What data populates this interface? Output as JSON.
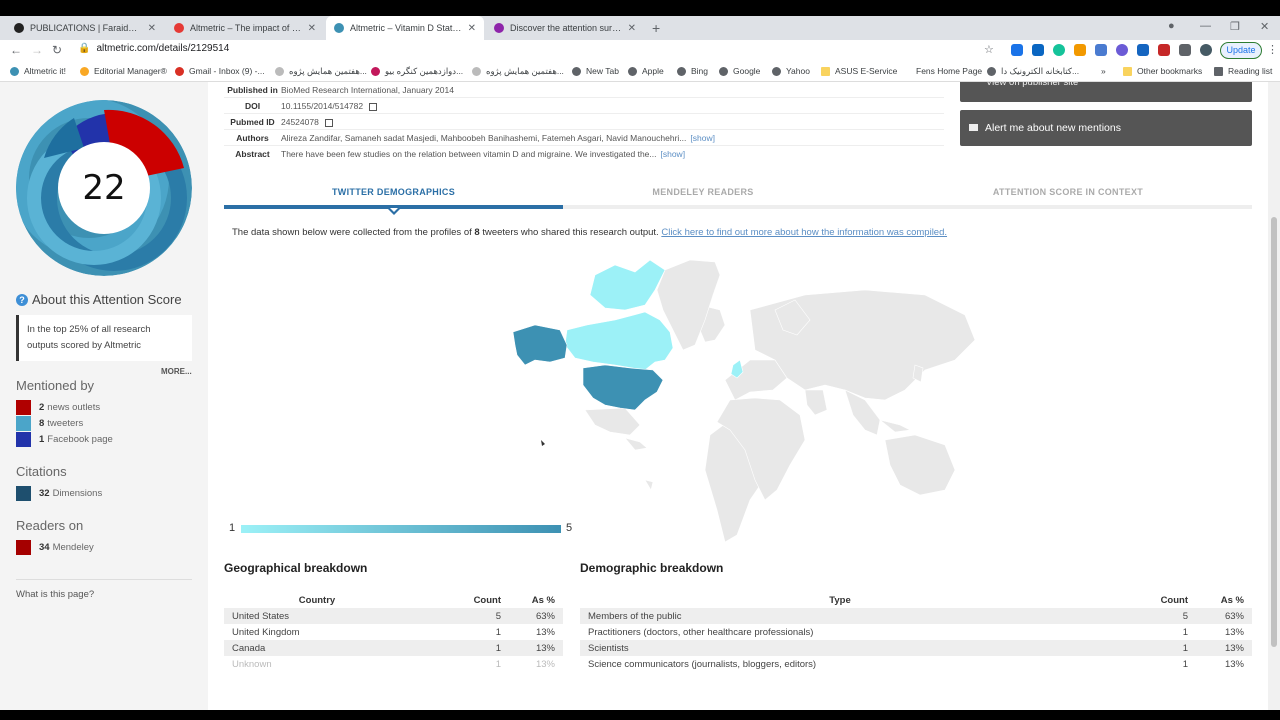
{
  "browser": {
    "tabs": [
      {
        "title": "PUBLICATIONS | Faraidoonhaghc",
        "color": "#222"
      },
      {
        "title": "Altmetric – The impact of Corona",
        "color": "#e53935"
      },
      {
        "title": "Altmetric – Vitamin D Status in M",
        "color": "#3d91b3"
      },
      {
        "title": "Discover the attention surroundi",
        "color": "#8e24aa"
      }
    ],
    "url": "altmetric.com/details/2129514",
    "update_label": "Update",
    "bookmarks": [
      "Altmetric it!",
      "Editorial Manager®",
      "Gmail - Inbox (9) -...",
      "هفتمین همایش پژوه...",
      "دوازدهمین کنگره بیو...",
      "هفتمین همایش پژوه...",
      "New Tab",
      "Apple",
      "Bing",
      "Google",
      "Yahoo",
      "ASUS E-Service",
      "Fens Home Page",
      "کتابخانه الکترونیک دا...",
      "»",
      "Other bookmarks",
      "Reading list"
    ]
  },
  "sidebar": {
    "score": "22",
    "about_title": "About this Attention Score",
    "about_text": "In the top 25% of all research outputs scored by Altmetric",
    "more_label": "MORE...",
    "mentioned_by_title": "Mentioned by",
    "mentions": [
      {
        "count": "2",
        "label": "news outlets",
        "color": "#b00000"
      },
      {
        "count": "8",
        "label": "tweeters",
        "color": "#4ba5c9"
      },
      {
        "count": "1",
        "label": "Facebook page",
        "color": "#2233aa"
      }
    ],
    "citations_title": "Citations",
    "citations": {
      "count": "32",
      "label": "Dimensions",
      "color": "#1e4f6e"
    },
    "readers_title": "Readers on",
    "readers": {
      "count": "34",
      "label": "Mendeley",
      "color": "#a50000"
    },
    "what_is": "What is this page?"
  },
  "details": {
    "published_label": "Published in",
    "published_value": "BioMed Research International, January 2014",
    "doi_label": "DOI",
    "doi_value": "10.1155/2014/514782",
    "pubmed_label": "Pubmed ID",
    "pubmed_value": "24524078",
    "authors_label": "Authors",
    "authors_value": "Alireza Zandifar, Samaneh sadat Masjedi, Mahboobeh Banihashemi, Fatemeh Asgari, Navid Manouchehri...",
    "abstract_label": "Abstract",
    "abstract_value": "There have been few studies on the relation between vitamin D and migraine. We investigated the...",
    "show_label": "[show]"
  },
  "actions": {
    "publisher_label": "View on publisher site",
    "alert_label": "Alert me about new mentions"
  },
  "tabs": {
    "twitter": "TWITTER DEMOGRAPHICS",
    "mendeley": "MENDELEY READERS",
    "context": "ATTENTION SCORE IN CONTEXT"
  },
  "intro": {
    "prefix": "The data shown below were collected from the profiles of",
    "count": "8",
    "suffix": "tweeters who shared this research output.",
    "link": "Click here to find out more about how the information was compiled."
  },
  "map": {
    "legend_min": "1",
    "legend_max": "5",
    "colors": {
      "max": "#3d91b3",
      "min": "#9cf1f7",
      "none": "#e8e8e8"
    }
  },
  "geo": {
    "title": "Geographical breakdown",
    "headers": [
      "Country",
      "Count",
      "As %"
    ],
    "rows": [
      {
        "country": "United States",
        "count": "5",
        "pct": "63%"
      },
      {
        "country": "United Kingdom",
        "count": "1",
        "pct": "13%"
      },
      {
        "country": "Canada",
        "count": "1",
        "pct": "13%"
      },
      {
        "country": "Unknown",
        "count": "1",
        "pct": "13%"
      }
    ]
  },
  "demo": {
    "title": "Demographic breakdown",
    "headers": [
      "Type",
      "Count",
      "As %"
    ],
    "rows": [
      {
        "type": "Members of the public",
        "count": "5",
        "pct": "63%"
      },
      {
        "type": "Practitioners (doctors, other healthcare professionals)",
        "count": "1",
        "pct": "13%"
      },
      {
        "type": "Scientists",
        "count": "1",
        "pct": "13%"
      },
      {
        "type": "Science communicators (journalists, bloggers, editors)",
        "count": "1",
        "pct": "13%"
      }
    ]
  }
}
